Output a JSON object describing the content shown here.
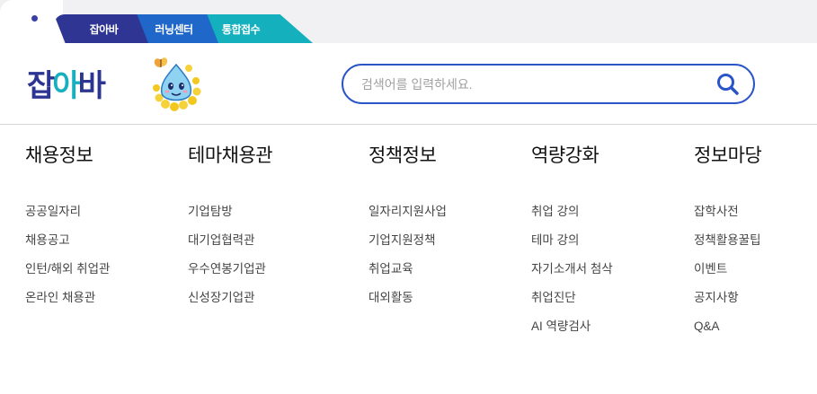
{
  "top_tabs": [
    {
      "label": "잡아바"
    },
    {
      "label": "러닝센터"
    },
    {
      "label": "통합접수"
    }
  ],
  "logo": {
    "text_part1": "잡",
    "text_part2": "아",
    "text_part3": "바"
  },
  "search": {
    "placeholder": "검색어를 입력하세요.",
    "value": ""
  },
  "menu": [
    {
      "title": "채용정보",
      "items": [
        "공공일자리",
        "채용공고",
        "인턴/해외 취업관",
        "온라인 채용관"
      ]
    },
    {
      "title": "테마채용관",
      "items": [
        "기업탐방",
        "대기업협력관",
        "우수연봉기업관",
        "신성장기업관"
      ]
    },
    {
      "title": "정책정보",
      "items": [
        "일자리지원사업",
        "기업지원정책",
        "취업교육",
        "대외활동"
      ]
    },
    {
      "title": "역량강화",
      "items": [
        "취업 강의",
        "테마 강의",
        "자기소개서 첨삭",
        "취업진단",
        "AI 역량검사"
      ]
    },
    {
      "title": "정보마당",
      "items": [
        "잡학사전",
        "정책활용꿀팁",
        "이벤트",
        "공지사항",
        "Q&A"
      ]
    }
  ],
  "colors": {
    "navy": "#2f3593",
    "blue": "#1f67c8",
    "teal": "#15b0bd",
    "search_border": "#2a55c8"
  }
}
